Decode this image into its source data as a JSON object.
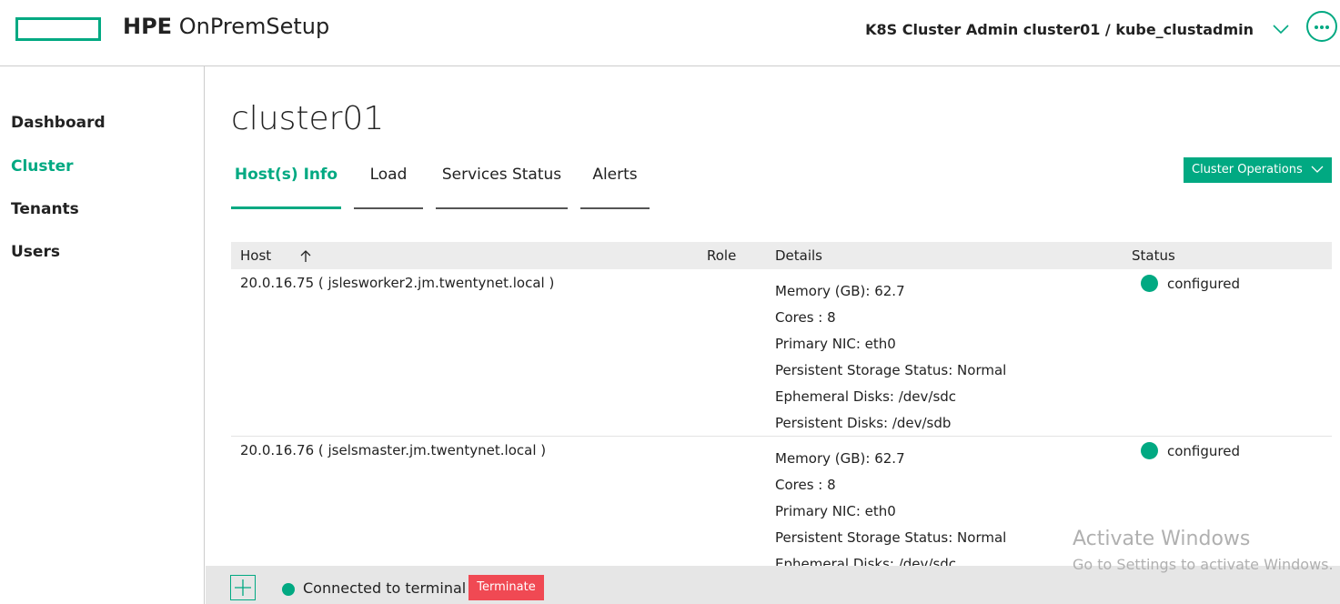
{
  "header": {
    "brand_bold": "HPE",
    "brand_name": "OnPremSetup",
    "context": "K8S Cluster Admin cluster01 / kube_clustadmin",
    "accent": "#01a982"
  },
  "sidebar": {
    "items": [
      {
        "label": "Dashboard"
      },
      {
        "label": "Cluster"
      },
      {
        "label": "Tenants"
      },
      {
        "label": "Users"
      }
    ]
  },
  "main": {
    "title": "cluster01",
    "tabs": [
      {
        "label": "Host(s) Info"
      },
      {
        "label": "Load"
      },
      {
        "label": "Services Status"
      },
      {
        "label": "Alerts"
      }
    ],
    "ops_button": "Cluster Operations"
  },
  "table": {
    "columns": [
      "Host",
      "Role",
      "Details",
      "Status"
    ],
    "rows": [
      {
        "host": "20.0.16.75 ( jslesworker2.jm.twentynet.local )",
        "role": "",
        "details": [
          "Memory (GB): 62.7",
          "Cores : 8",
          "Primary NIC: eth0",
          "Persistent Storage Status: Normal",
          "Ephemeral Disks: /dev/sdc",
          "Persistent Disks: /dev/sdb"
        ],
        "status": "configured"
      },
      {
        "host": "20.0.16.76 ( jselsmaster.jm.twentynet.local )",
        "role": "",
        "details": [
          "Memory (GB): 62.7",
          "Cores : 8",
          "Primary NIC: eth0",
          "Persistent Storage Status: Normal",
          "Ephemeral Disks: /dev/sdc"
        ],
        "status": "configured"
      }
    ]
  },
  "watermark": {
    "line1": "Activate Windows",
    "line2": "Go to Settings to activate Windows."
  },
  "footer": {
    "connection": "Connected to terminal",
    "terminate": "Terminate",
    "terminate_color": "#f04953"
  }
}
